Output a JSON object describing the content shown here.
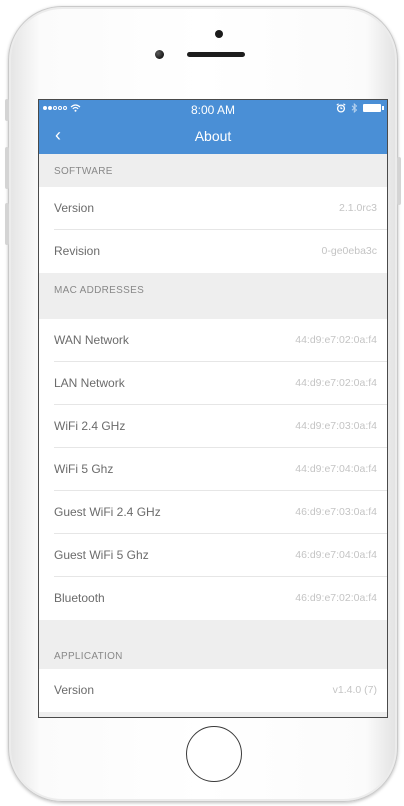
{
  "status_bar": {
    "time": "8:00 AM"
  },
  "nav": {
    "back_glyph": "‹",
    "title": "About"
  },
  "sections": {
    "software": {
      "header": "SOFTWARE",
      "rows": [
        {
          "label": "Version",
          "value": "2.1.0rc3"
        },
        {
          "label": "Revision",
          "value": "0-ge0eba3c"
        }
      ]
    },
    "mac": {
      "header": "MAC ADDRESSES",
      "rows": [
        {
          "label": "WAN Network",
          "value": "44:d9:e7:02:0a:f4"
        },
        {
          "label": "LAN Network",
          "value": "44:d9:e7:02:0a:f4"
        },
        {
          "label": "WiFi 2.4 GHz",
          "value": "44:d9:e7:03:0a:f4"
        },
        {
          "label": "WiFi 5 Ghz",
          "value": "44:d9:e7:04:0a:f4"
        },
        {
          "label": "Guest WiFi 2.4 GHz",
          "value": "46:d9:e7:03:0a:f4"
        },
        {
          "label": "Guest WiFi 5 Ghz",
          "value": "46:d9:e7:04:0a:f4"
        },
        {
          "label": "Bluetooth",
          "value": "46:d9:e7:02:0a:f4"
        }
      ]
    },
    "application": {
      "header": "APPLICATION",
      "rows": [
        {
          "label": "Version",
          "value": "v1.4.0 (7)"
        }
      ]
    }
  },
  "icons": [
    "signal-dots-icon",
    "wifi-icon",
    "alarm-icon",
    "bluetooth-icon",
    "battery-icon",
    "back-chevron-icon",
    "home-button"
  ],
  "colors": {
    "nav_background": "#4a8fd6",
    "section_background": "#eeeeee",
    "row_background": "#ffffff",
    "value_text": "#c4c4c4"
  }
}
